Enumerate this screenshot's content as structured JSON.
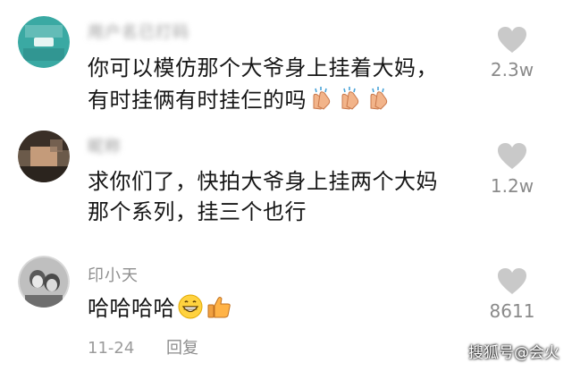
{
  "comments": [
    {
      "username": "用户名已打码",
      "text_line1": "你可以模仿那个大爷身上挂着大妈，",
      "text_line2": "有时挂俩有时挂仨的吗",
      "emoji": [
        "clapping-hands",
        "clapping-hands",
        "clapping-hands"
      ],
      "likes": "2.3w"
    },
    {
      "username": "昵称",
      "text_line1": "求你们了，快拍大爷身上挂两个大妈",
      "text_line2": "那个系列，挂三个也行",
      "likes": "1.2w"
    },
    {
      "username": "印小天",
      "text_line1": "哈哈哈哈",
      "emoji": [
        "grinning-face",
        "thumbs-up"
      ],
      "likes": "8611"
    }
  ],
  "footer": {
    "date": "11-24",
    "reply_label": "回复"
  },
  "watermark": "搜狐号@会火",
  "colors": {
    "heart": "#c9c9c9",
    "meta_text": "#8f8f8f",
    "body_text": "#161616"
  }
}
